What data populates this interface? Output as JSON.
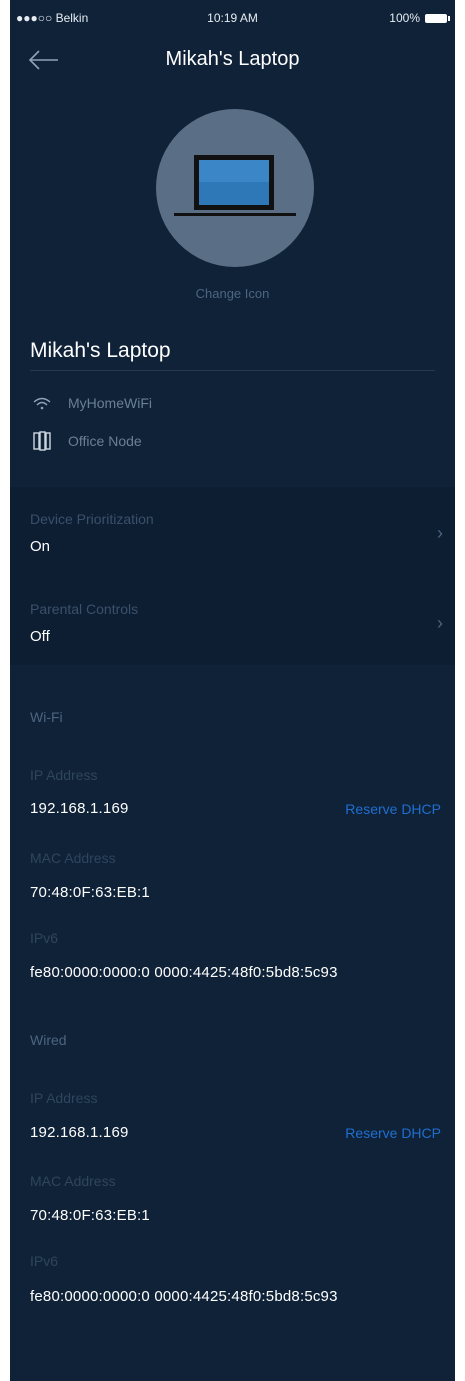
{
  "status_bar": {
    "carrier": "●●●○○ Belkin",
    "time": "10:19 AM",
    "battery": "100%"
  },
  "nav": {
    "title": "Mikah's Laptop",
    "back_icon": "arrow-left-icon"
  },
  "device": {
    "icon": "laptop-icon",
    "change_icon_label": "Change Icon",
    "name": "Mikah's Laptop",
    "network": "MyHomeWiFi",
    "node": "Office Node"
  },
  "settings": [
    {
      "label": "Device Prioritization",
      "value": "On"
    },
    {
      "label": "Parental Controls",
      "value": "Off"
    }
  ],
  "wifi": {
    "header": "Wi-Fi",
    "ip_label": "IP Address",
    "ip": "192.168.1.169",
    "reserve": "Reserve DHCP",
    "mac_label": "MAC Address",
    "mac": "70:48:0F:63:EB:1",
    "ipv6_label": "IPv6",
    "ipv6": "fe80:0000:0000:0 0000:4425:48f0:5bd8:5c93"
  },
  "wired": {
    "header": "Wired",
    "ip_label": "IP Address",
    "ip": "192.168.1.169",
    "reserve": "Reserve DHCP",
    "mac_label": "MAC Address",
    "mac": "70:48:0F:63:EB:1",
    "ipv6_label": "IPv6",
    "ipv6": "fe80:0000:0000:0 0000:4425:48f0:5bd8:5c93"
  },
  "colors": {
    "background": "#0f2238",
    "panel": "#0d1e33",
    "accent": "#1f6fd1"
  }
}
